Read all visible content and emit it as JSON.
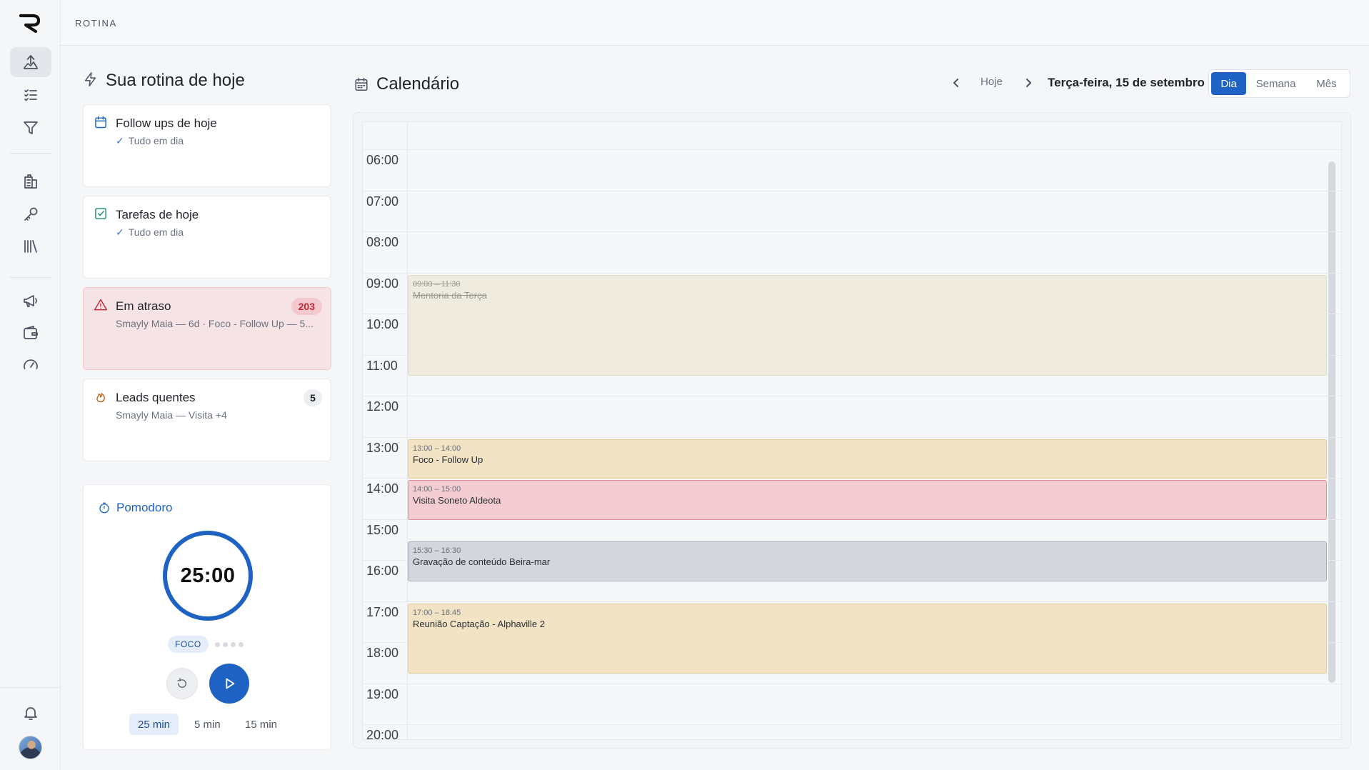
{
  "app": {
    "title": "ROTINA"
  },
  "sidebar": {
    "items": [
      {
        "name": "rotina-icon",
        "active": true
      },
      {
        "name": "tasks-list-icon"
      },
      {
        "name": "funnel-icon"
      },
      {
        "name": "building-icon"
      },
      {
        "name": "key-icon"
      },
      {
        "name": "library-icon"
      },
      {
        "name": "megaphone-icon"
      },
      {
        "name": "wallet-icon"
      },
      {
        "name": "speedometer-icon"
      },
      {
        "name": "bell-icon"
      }
    ]
  },
  "routine": {
    "title": "Sua rotina de hoje",
    "cards": [
      {
        "title": "Follow ups de hoje",
        "subtitle": "Tudo em dia",
        "check": "✓"
      },
      {
        "title": "Tarefas de hoje",
        "subtitle": "Tudo em dia",
        "check": "✓"
      },
      {
        "title": "Em atraso",
        "subtitle": "Smayly Maia — 6d · Foco - Follow Up — 5...",
        "badge": "203"
      },
      {
        "title": "Leads quentes",
        "subtitle": "Smayly Maia — Visita +4",
        "badge": "5"
      }
    ]
  },
  "pomodoro": {
    "title": "Pomodoro",
    "time": "25:00",
    "mode": "FOCO",
    "durations": [
      "25 min",
      "5 min",
      "15 min"
    ],
    "active_duration": "25 min"
  },
  "calendar": {
    "title": "Calendário",
    "today_label": "Hoje",
    "date_label": "Terça-feira, 15 de setembro",
    "views": [
      "Dia",
      "Semana",
      "Mês"
    ],
    "active_view": "Dia",
    "hours": [
      "06:00",
      "07:00",
      "08:00",
      "09:00",
      "10:00",
      "11:00",
      "12:00",
      "13:00",
      "14:00",
      "15:00",
      "16:00",
      "17:00",
      "18:00",
      "19:00",
      "20:00"
    ],
    "events": [
      {
        "time": "09:00 – 11:30",
        "title": "Mentoria da Terça",
        "status": "done"
      },
      {
        "time": "13:00 – 14:00",
        "title": "Foco - Follow Up",
        "status": "focus"
      },
      {
        "time": "14:00 – 15:00",
        "title": "Visita Soneto Aldeota",
        "status": "visit"
      },
      {
        "time": "15:30 – 16:30",
        "title": "Gravação de conteúdo Beira-mar",
        "status": "recording"
      },
      {
        "time": "17:00 – 18:45",
        "title": "Reunião Captação - Alphaville 2",
        "status": "meeting"
      }
    ]
  },
  "colors": {
    "accent": "#1e63c4",
    "done_bg": "#efebdf",
    "focus_bg": "#f1e3c4",
    "visit_bg": "#f4cdd2",
    "recording_bg": "#d3d6dc",
    "meeting_bg": "#f1e3c4"
  }
}
